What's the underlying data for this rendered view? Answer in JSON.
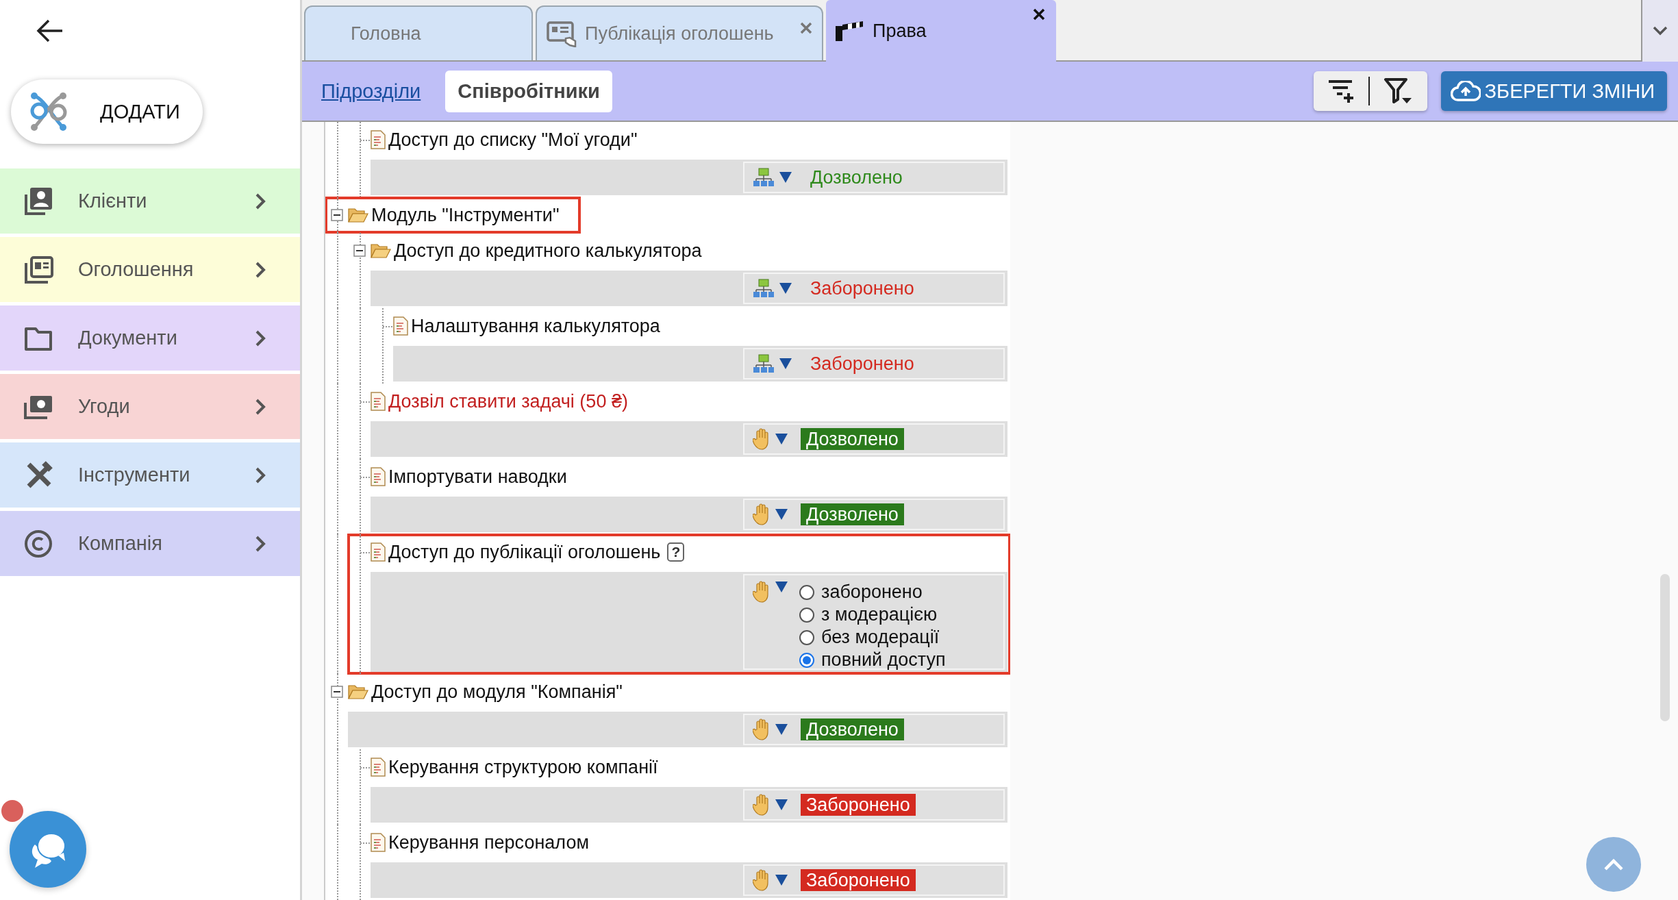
{
  "add_button": {
    "label": "ДОДАТИ"
  },
  "menu": [
    {
      "label": "Клієнти",
      "kind": "contacts",
      "color": "#dcfad6"
    },
    {
      "label": "Оголошення",
      "kind": "ads",
      "color": "#fdfdd8"
    },
    {
      "label": "Документи",
      "kind": "folder",
      "color": "#e3d6fa"
    },
    {
      "label": "Угоди",
      "kind": "money",
      "color": "#f8d4d4"
    },
    {
      "label": "Інструменти",
      "kind": "tools",
      "color": "#d6e6fa"
    },
    {
      "label": "Компанія",
      "kind": "copyright",
      "color": "#d2d2f7"
    }
  ],
  "tabs": [
    {
      "label": "Головна",
      "kind": "plain",
      "closable": false,
      "selected": false
    },
    {
      "label": "Публікація оголошень",
      "kind": "ads",
      "closable": true,
      "selected": false
    },
    {
      "label": "Права",
      "kind": "barrier",
      "closable": true,
      "selected": true
    }
  ],
  "subtabs": [
    {
      "label": "Підрозділи",
      "selected": false
    },
    {
      "label": "Співробітники",
      "selected": true
    }
  ],
  "save_button": {
    "label": "ЗБЕРЕГТИ ЗМІНИ"
  },
  "tree": {
    "items": [
      {
        "children": [
          {
            "label": "Доступ до списку \"Мої угоди\"",
            "kind": "doc",
            "warning": false,
            "highlighted": false,
            "permission": {
              "kind": "status",
              "inherited": true,
              "allowed": true,
              "value": "Дозволено"
            }
          }
        ]
      },
      {
        "label": "Модуль \"Інструменти\"",
        "kind": "folder",
        "expanded": true,
        "warning": false,
        "highlighted": true,
        "children": [
          {
            "label": "Доступ до кредитного калькулятора",
            "kind": "folder",
            "expanded": true,
            "warning": false,
            "highlighted": false,
            "permission": {
              "kind": "status",
              "inherited": true,
              "allowed": false,
              "value": "Заборонено"
            },
            "children": [
              {
                "label": "Налаштування калькулятора",
                "kind": "doc",
                "warning": false,
                "highlighted": false,
                "permission": {
                  "kind": "status",
                  "inherited": true,
                  "allowed": false,
                  "value": "Заборонено"
                }
              }
            ]
          },
          {
            "label": "Дозвіл ставити задачі (50 ₴)",
            "kind": "doc",
            "warning": true,
            "highlighted": false,
            "permission": {
              "kind": "status",
              "inherited": false,
              "allowed": true,
              "value": "Дозволено"
            }
          },
          {
            "label": "Імпортувати наводки",
            "kind": "doc",
            "warning": false,
            "highlighted": false,
            "permission": {
              "kind": "status",
              "inherited": false,
              "allowed": true,
              "value": "Дозволено"
            }
          },
          {
            "label": "Доступ до публікації оголошень",
            "kind": "doc",
            "warning": false,
            "highlighted": true,
            "help": "?",
            "permission": {
              "kind": "radio",
              "inherited": false,
              "options": [
                {
                  "label": "заборонено",
                  "selected": false
                },
                {
                  "label": "з модерацією",
                  "selected": false
                },
                {
                  "label": "без модерації",
                  "selected": false
                },
                {
                  "label": "повний доступ",
                  "selected": true
                }
              ]
            }
          }
        ]
      },
      {
        "label": "Доступ до модуля \"Компанія\"",
        "kind": "folder",
        "expanded": true,
        "warning": false,
        "highlighted": false,
        "permission": {
          "kind": "status",
          "inherited": false,
          "allowed": true,
          "value": "Дозволено"
        },
        "children": [
          {
            "label": "Керування структурою компанії",
            "kind": "doc",
            "warning": false,
            "highlighted": false,
            "permission": {
              "kind": "status",
              "inherited": false,
              "allowed": false,
              "value": "Заборонено"
            }
          },
          {
            "label": "Керування персоналом",
            "kind": "doc",
            "warning": false,
            "highlighted": false,
            "permission": {
              "kind": "status",
              "inherited": false,
              "allowed": false,
              "value": "Заборонено"
            }
          }
        ]
      }
    ]
  },
  "chat": {
    "unread": true
  }
}
